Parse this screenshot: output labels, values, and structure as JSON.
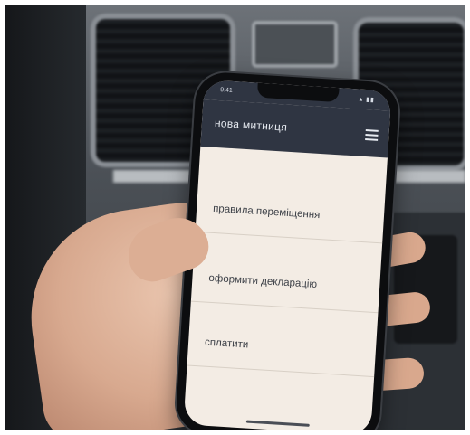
{
  "status": {
    "time": "9:41",
    "icons": "▴ ▮▮"
  },
  "app": {
    "title": "нова митниця",
    "menu_icon": "hamburger-menu-icon"
  },
  "menu": {
    "items": [
      {
        "label": "правила переміщення"
      },
      {
        "label": "оформити декларацію"
      },
      {
        "label": "сплатити"
      }
    ]
  }
}
